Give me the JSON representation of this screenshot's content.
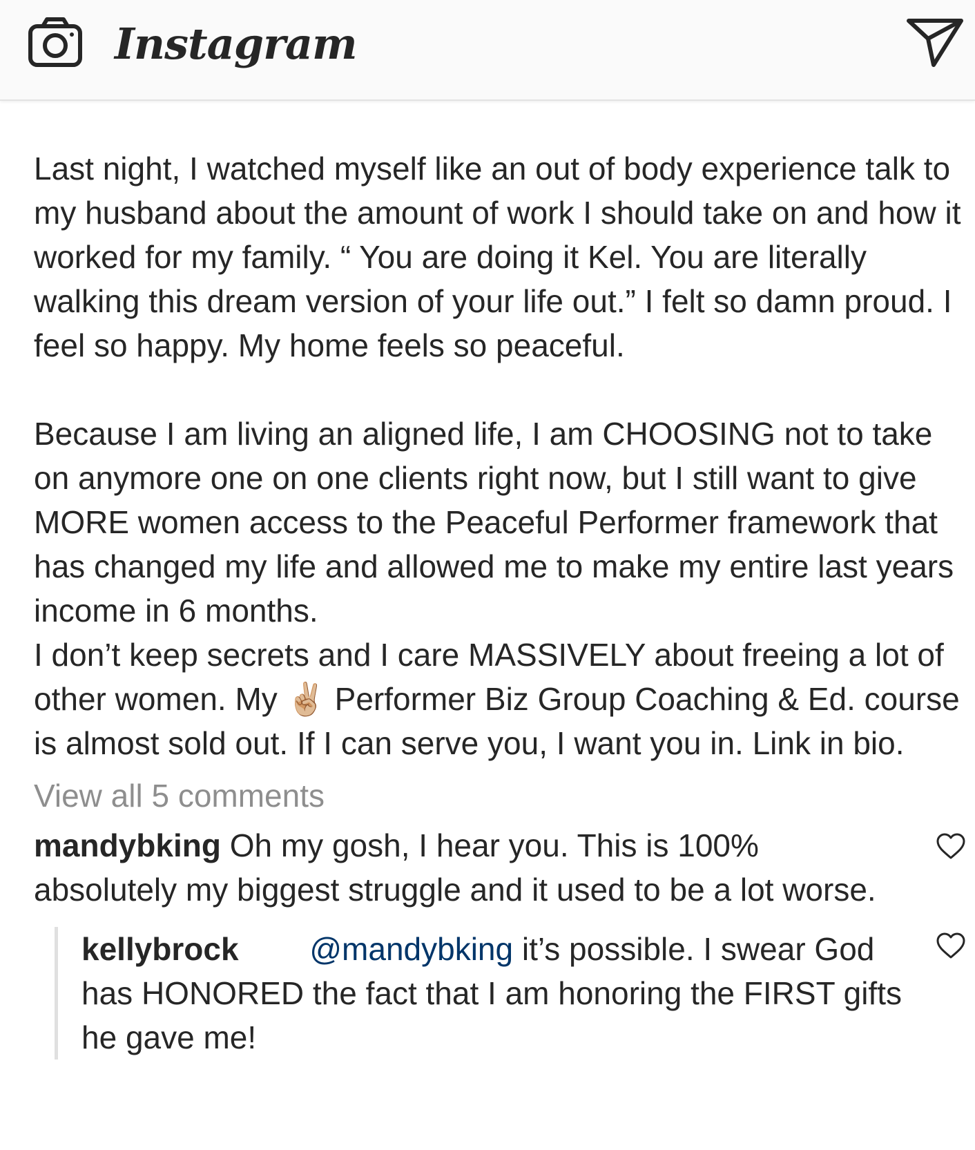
{
  "header": {
    "title": "Instagram",
    "camera_icon": "camera-icon",
    "send_icon": "direct-message-icon"
  },
  "caption": {
    "paragraph1": "Last night, I watched myself like an out of body experience talk to my husband about the amount of work I should take on and how it worked for my family. “ You are doing it Kel. You are literally walking this dream version of your life out.” I felt so damn proud. I feel so happy. My home feels so peaceful.",
    "paragraph2": "Because I am living an aligned life, I am CHOOSING not to take on anymore one on one clients right now, but I still want to give MORE women access to the Peaceful Performer framework that has changed my life and allowed me to make my entire last years income in 6 months.",
    "paragraph3_before_emoji": "I don’t keep secrets and I care MASSIVELY about freeing a lot of other women. My",
    "emoji": "✌🏼",
    "paragraph3_after_emoji": " Performer Biz Group Coaching & Ed. course is almost sold out. If I can serve you, I want you in. Link in bio."
  },
  "comments": {
    "view_all_label": "View all 5 comments",
    "items": [
      {
        "username": "mandybking",
        "text": " Oh my gosh, I hear you. This is 100% absolutely my biggest struggle and it used to be a lot worse.",
        "like_icon": "heart-outline-icon"
      }
    ],
    "reply": {
      "username": "kellybrock",
      "mention": "@mandybking",
      "text": " it’s possible. I swear God has HONORED the fact that I am honoring the FIRST gifts he gave me!",
      "like_icon": "heart-outline-icon"
    }
  },
  "colors": {
    "text": "#262626",
    "muted": "#8e8e8e",
    "mention": "#003569",
    "header_bg": "#fafafa"
  }
}
